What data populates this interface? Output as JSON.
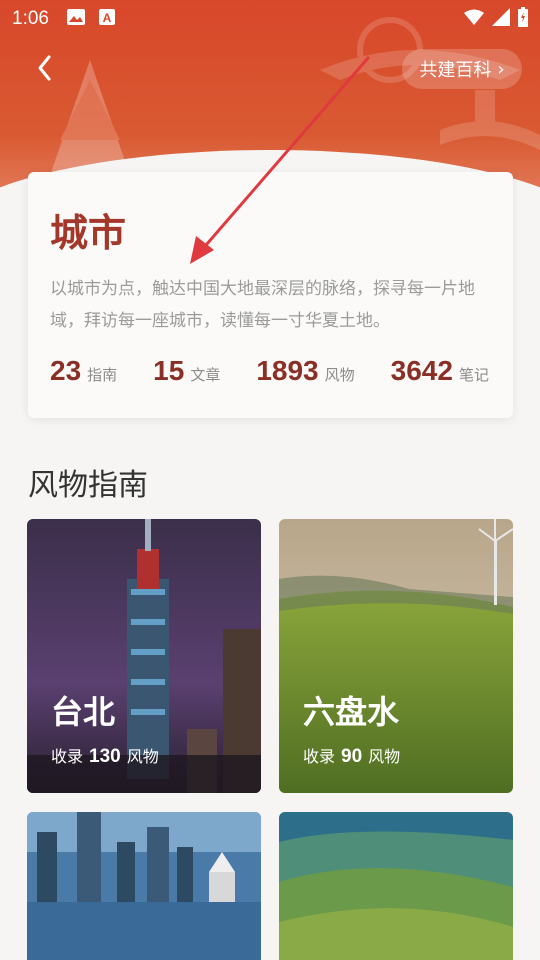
{
  "statusbar": {
    "time": "1:06"
  },
  "header": {
    "back_label": "‹",
    "contribute_label": "共建百科",
    "contribute_chevron": "›"
  },
  "card": {
    "title": "城市",
    "description": "以城市为点，触达中国大地最深层的脉络，探寻每一片地域，拜访每一座城市，读懂每一寸华夏土地。",
    "stats": [
      {
        "value": "23",
        "label": "指南"
      },
      {
        "value": "15",
        "label": "文章"
      },
      {
        "value": "1893",
        "label": "风物"
      },
      {
        "value": "3642",
        "label": "笔记"
      }
    ]
  },
  "section": {
    "title": "风物指南"
  },
  "tiles": [
    {
      "name": "台北",
      "prefix": "收录",
      "count": "130",
      "suffix": "风物"
    },
    {
      "name": "六盘水",
      "prefix": "收录",
      "count": "90",
      "suffix": "风物"
    },
    {
      "name": "",
      "prefix": "",
      "count": "",
      "suffix": ""
    },
    {
      "name": "",
      "prefix": "",
      "count": "",
      "suffix": ""
    }
  ],
  "colors": {
    "accent": "#a3372a",
    "banner": "#d8472a",
    "stat": "#8a2f25",
    "arrow": "#e0393e"
  }
}
